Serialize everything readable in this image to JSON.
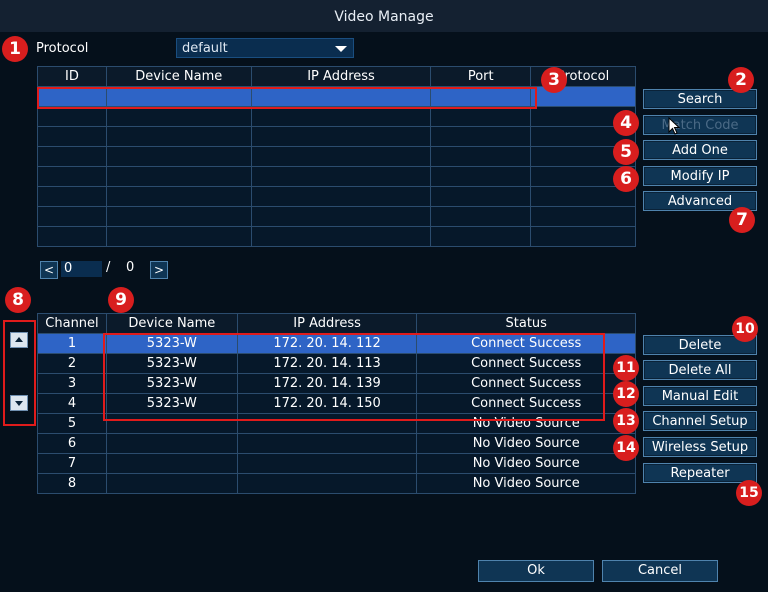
{
  "window": {
    "title": "Video Manage"
  },
  "protocol": {
    "label": "Protocol",
    "value": "default"
  },
  "search_table": {
    "headers": [
      "ID",
      "Device Name",
      "IP Address",
      "Port",
      "Protocol"
    ],
    "rows": 8
  },
  "pagination": {
    "current": "0",
    "separator": "/",
    "total": "0",
    "prev": "<",
    "next": ">"
  },
  "side_buttons_top": {
    "search": "Search",
    "match_code": "Match Code",
    "add_one": "Add One",
    "modify_ip": "Modify IP",
    "advanced": "Advanced"
  },
  "channel_table": {
    "headers": [
      "Channel",
      "Device Name",
      "IP Address",
      "Status"
    ],
    "rows": [
      {
        "channel": "1",
        "device": "5323-W",
        "ip": "172. 20. 14. 112",
        "status": "Connect Success"
      },
      {
        "channel": "2",
        "device": "5323-W",
        "ip": "172. 20. 14. 113",
        "status": "Connect Success"
      },
      {
        "channel": "3",
        "device": "5323-W",
        "ip": "172. 20. 14. 139",
        "status": "Connect Success"
      },
      {
        "channel": "4",
        "device": "5323-W",
        "ip": "172. 20. 14. 150",
        "status": "Connect Success"
      },
      {
        "channel": "5",
        "device": "",
        "ip": "",
        "status": "No Video Source"
      },
      {
        "channel": "6",
        "device": "",
        "ip": "",
        "status": "No Video Source"
      },
      {
        "channel": "7",
        "device": "",
        "ip": "",
        "status": "No Video Source"
      },
      {
        "channel": "8",
        "device": "",
        "ip": "",
        "status": "No Video Source"
      }
    ]
  },
  "side_buttons_bottom": {
    "delete": "Delete",
    "delete_all": "Delete All",
    "manual_edit": "Manual Edit",
    "channel_setup": "Channel Setup",
    "wireless_setup": "Wireless Setup",
    "repeater": "Repeater"
  },
  "footer": {
    "ok": "Ok",
    "cancel": "Cancel"
  },
  "badges": [
    "1",
    "2",
    "3",
    "4",
    "5",
    "6",
    "7",
    "8",
    "9",
    "10",
    "11",
    "12",
    "13",
    "14",
    "15"
  ],
  "colors": {
    "selected_row": "#2e64c6",
    "badge": "#d81e1e",
    "button": "#0f3554"
  }
}
